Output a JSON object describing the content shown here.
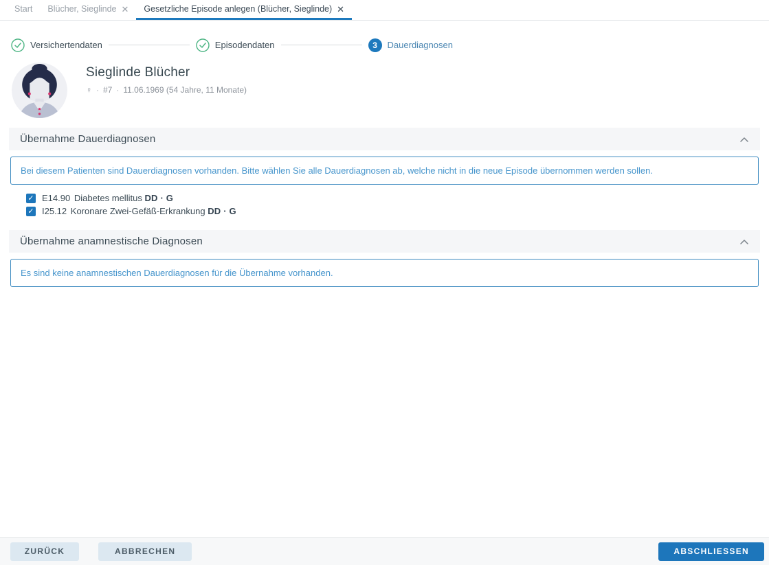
{
  "tabs": [
    {
      "label": "Start",
      "closable": false,
      "active": false
    },
    {
      "label": "Blücher, Sieglinde",
      "closable": true,
      "active": false
    },
    {
      "label": "Gesetzliche Episode anlegen (Blücher, Sieglinde)",
      "closable": true,
      "active": true
    }
  ],
  "close_glyph": "✕",
  "stepper": {
    "steps": [
      {
        "label": "Versichertendaten",
        "state": "completed"
      },
      {
        "label": "Episodendaten",
        "state": "completed"
      },
      {
        "label": "Dauerdiagnosen",
        "state": "active",
        "number": "3"
      }
    ]
  },
  "patient": {
    "name": "Sieglinde Blücher",
    "gender_symbol": "♀",
    "patient_number": "#7",
    "birth_info": "11.06.1969 (54 Jahre, 11 Monate)",
    "separator": "·"
  },
  "sections": [
    {
      "title": "Übernahme Dauerdiagnosen",
      "info": "Bei diesem Patienten sind Dauerdiagnosen vorhanden. Bitte wählen Sie alle Dauerdiagnosen ab, welche nicht in die neue Episode übernommen werden sollen.",
      "diagnoses": [
        {
          "code": "E14.90",
          "name": "Diabetes mellitus",
          "badge": "DD · G",
          "checked": true,
          "check_glyph": "✓"
        },
        {
          "code": "I25.12",
          "name": "Koronare Zwei-Gefäß-Erkrankung",
          "badge": "DD · G",
          "checked": true,
          "check_glyph": "✓"
        }
      ]
    },
    {
      "title": "Übernahme anamnestische Diagnosen",
      "info": "Es sind keine anamnestischen Dauerdiagnosen für die Übernahme vorhanden."
    }
  ],
  "footer": {
    "back_label": "ZURÜCK",
    "cancel_label": "ABBRECHEN",
    "finish_label": "ABSCHLIESSEN"
  },
  "colors": {
    "primary_blue": "#1d76bb",
    "info_blue": "#4695cc",
    "success_green": "#4db584",
    "text_dark": "#3b4a54",
    "text_gray": "#8d939b"
  }
}
